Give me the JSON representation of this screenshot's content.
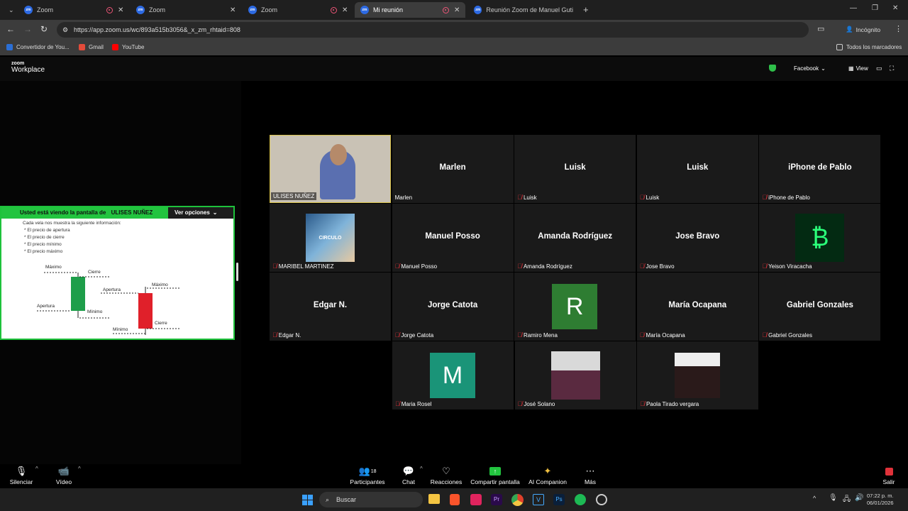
{
  "browser": {
    "tabs": [
      {
        "label": "Zoom",
        "active": false
      },
      {
        "label": "Zoom",
        "active": false
      },
      {
        "label": "Zoom",
        "active": false
      },
      {
        "label": "Mi reunión",
        "active": true
      },
      {
        "label": "Reunión Zoom de Manuel Guti",
        "active": false
      }
    ],
    "url": "https://app.zoom.us/wc/893a515b3056&_x_zm_rhtaid=808",
    "incognito": "Incógnito",
    "bookmarks": [
      "Convertidor de You...",
      "Gmail",
      "YouTube"
    ],
    "all_bookmarks": "Todos los marcadores"
  },
  "zoom_header": {
    "logo_top": "zoom",
    "logo_bottom": "Workplace",
    "app": "Facebook",
    "view": "View"
  },
  "share": {
    "banner_prefix": "Usted está viendo la pantalla de",
    "banner_name": "ULISES NUÑEZ",
    "options": "Ver opciones",
    "intro": "Cada vela nos muestra la siguiente información:",
    "bullets": [
      "* El precio de apertura",
      "* El precio de cierre",
      "* El precio mínimo",
      "* El precio máximo"
    ],
    "labels": {
      "max1": "Máximo",
      "close1": "Cierre",
      "open1": "Apertura",
      "min1": "Mínimo",
      "open2": "Apertura",
      "max2": "Máximo",
      "close2": "Cierre",
      "min2": "Mínimo"
    },
    "colors": {
      "bull": "#1e9e4a",
      "bear": "#e0202a"
    }
  },
  "participants": [
    {
      "name": "",
      "label": "ULISES NUÑEZ",
      "muted": false,
      "type": "video"
    },
    {
      "name": "Marlen",
      "label": "Marlen",
      "muted": false,
      "type": "name"
    },
    {
      "name": "Luisk",
      "label": "Luisk",
      "muted": true,
      "type": "name"
    },
    {
      "name": "Luisk",
      "label": "Luisk",
      "muted": true,
      "type": "name"
    },
    {
      "name": "iPhone de Pablo",
      "label": "iPhone de Pablo",
      "muted": true,
      "type": "name"
    },
    {
      "name": "",
      "label": "MARIBEL MARTINEZ",
      "muted": true,
      "type": "picture",
      "pic_text": "CIRCULO"
    },
    {
      "name": "Manuel Posso",
      "label": "Manuel Posso",
      "muted": true,
      "type": "name"
    },
    {
      "name": "Amanda Rodríguez",
      "label": "Amanda Rodríguez",
      "muted": true,
      "type": "name"
    },
    {
      "name": "Jose Bravo",
      "label": "Jose Bravo",
      "muted": true,
      "type": "name"
    },
    {
      "name": "",
      "label": "Yeison Viracacha",
      "muted": true,
      "type": "bitcoin"
    },
    {
      "name": "Edgar N.",
      "label": "Edgar N.",
      "muted": true,
      "type": "name"
    },
    {
      "name": "Jorge Catota",
      "label": "Jorge Catota",
      "muted": true,
      "type": "name"
    },
    {
      "name": "",
      "label": "Ramiro Mena",
      "muted": true,
      "type": "letter",
      "letter": "R",
      "color": "#2e7d32"
    },
    {
      "name": "María Ocapana",
      "label": "María Ocapana",
      "muted": true,
      "type": "name"
    },
    {
      "name": "Gabriel Gonzales",
      "label": "Gabriel Gonzales",
      "muted": true,
      "type": "name"
    },
    {
      "name": "",
      "label": "Maria Rosel",
      "muted": true,
      "type": "letter",
      "letter": "M",
      "color": "#1a9478"
    },
    {
      "name": "",
      "label": "José Solano",
      "muted": true,
      "type": "photo"
    },
    {
      "name": "",
      "label": "Paola Tirado vergara",
      "muted": true,
      "type": "photo2"
    }
  ],
  "toolbar": {
    "mute": "Silenciar",
    "video": "Vídeo",
    "participants": "Participantes",
    "participants_count": "18",
    "chat": "Chat",
    "reactions": "Reacciones",
    "share": "Compartir pantalla",
    "ai": "AI Companion",
    "more": "Más",
    "leave": "Salir"
  },
  "taskbar": {
    "search": "Buscar",
    "time": "07:22 p. m.",
    "date": "06/01/2026"
  }
}
